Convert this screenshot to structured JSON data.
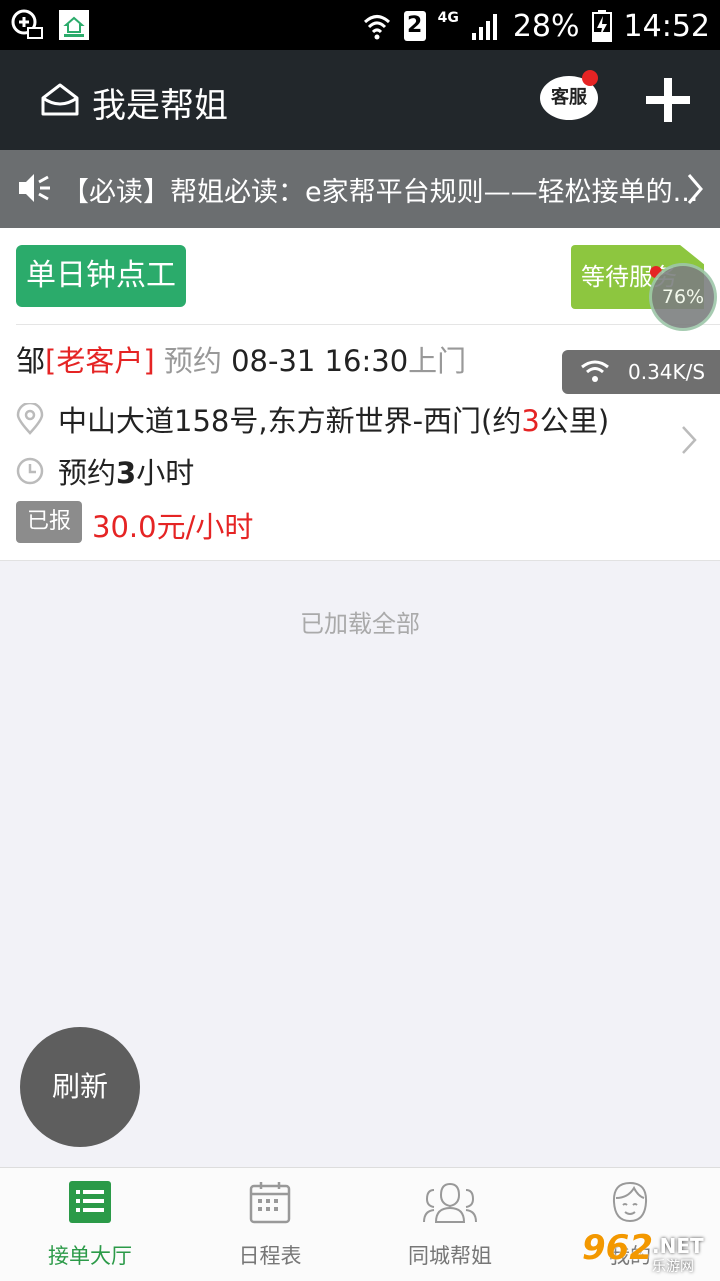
{
  "status_bar": {
    "sim": "2",
    "network": "4G",
    "battery": "28%",
    "time": "14:52"
  },
  "header": {
    "title": "我是帮姐",
    "service_label": "客服"
  },
  "notice": {
    "text": "【必读】帮姐必读：e家帮平台规则——轻松接单的..."
  },
  "order": {
    "type": "单日钟点工",
    "status": "等待服务",
    "progress": "76%",
    "customer_name": "邹",
    "customer_tag": "[老客户]",
    "booking_prefix": "预约",
    "datetime": "08-31 16:30",
    "booking_suffix": "上门",
    "net_speed": "0.34K/S",
    "address_before": "中山大道158号,东方新世界-西门(约",
    "distance": "3",
    "address_after": "公里)",
    "duration_prefix": "预约",
    "duration_hours": "3",
    "duration_suffix": "小时",
    "reported_label": "已报",
    "price": "30.0元/小时"
  },
  "list_footer": "已加载全部",
  "refresh_label": "刷新",
  "nav": {
    "items": [
      {
        "label": "接单大厅",
        "icon": "list-icon",
        "active": true
      },
      {
        "label": "日程表",
        "icon": "calendar-icon",
        "active": false
      },
      {
        "label": "同城帮姐",
        "icon": "people-icon",
        "active": false
      },
      {
        "label": "我的",
        "icon": "face-icon",
        "active": false
      }
    ]
  },
  "watermark": {
    "number": "962",
    "net": ".NET",
    "sub": "乐游网"
  },
  "colors": {
    "accent_green": "#2bab6b",
    "status_green": "#8dc63f",
    "price_red": "#e52424",
    "header_bg": "#22272b"
  }
}
